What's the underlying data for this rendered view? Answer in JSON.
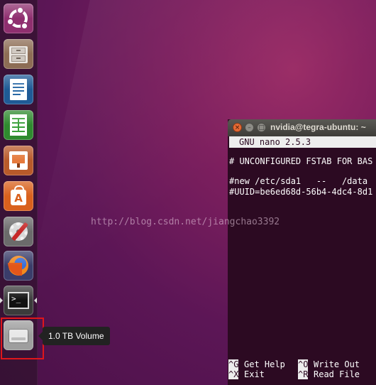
{
  "launcher": {
    "items": [
      {
        "name": "Search your computer",
        "icon": "ubuntu-dash-icon"
      },
      {
        "name": "Files",
        "icon": "file-cabinet-icon"
      },
      {
        "name": "LibreOffice Writer",
        "icon": "writer-document-icon"
      },
      {
        "name": "LibreOffice Calc",
        "icon": "spreadsheet-icon"
      },
      {
        "name": "LibreOffice Impress",
        "icon": "presentation-icon"
      },
      {
        "name": "Ubuntu Software",
        "icon": "shopping-bag-icon",
        "glyph": "A"
      },
      {
        "name": "System Settings",
        "icon": "settings-gear-icon"
      },
      {
        "name": "Firefox Web Browser",
        "icon": "firefox-icon"
      },
      {
        "name": "Terminal",
        "icon": "terminal-icon",
        "glyph": ">_"
      },
      {
        "name": "1.0 TB Volume",
        "icon": "drive-icon"
      }
    ],
    "tooltip": "1.0 TB Volume"
  },
  "terminal": {
    "title": "nvidia@tegra-ubuntu: ~",
    "nano_header": "GNU nano 2.5.3",
    "lines": [
      "# UNCONFIGURED FSTAB FOR BAS",
      "#new /etc/sda1   --   /data",
      "#UUID=be6ed68d-56b4-4dc4-8d1"
    ],
    "shortcuts": [
      {
        "key": "^G",
        "label": "Get Help"
      },
      {
        "key": "^O",
        "label": "Write Out"
      },
      {
        "key": "^X",
        "label": "Exit"
      },
      {
        "key": "^R",
        "label": "Read File"
      }
    ]
  },
  "watermark": "http://blog.csdn.net/jiangchao3392",
  "colors": {
    "highlight_box": "#e0161b",
    "terminal_bg": "#2c0a22",
    "tooltip_bg": "#222222"
  }
}
